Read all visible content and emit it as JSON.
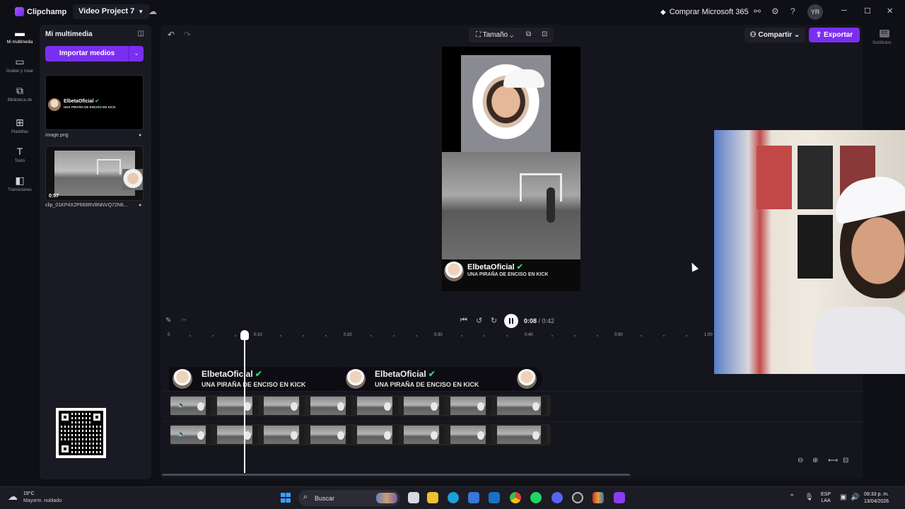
{
  "titlebar": {
    "app_name": "Clipchamp",
    "project_name": "Video Project 7",
    "buy_label": "Comprar Microsoft 365",
    "avatar_initials": "YR"
  },
  "rail": {
    "items": [
      {
        "label": "Mi multimedia",
        "icon": "folder-icon"
      },
      {
        "label": "Grabar y crear",
        "icon": "camera-icon"
      },
      {
        "label": "Biblioteca de",
        "icon": "library-icon"
      },
      {
        "label": "Plantillas",
        "icon": "templates-icon"
      },
      {
        "label": "Texto",
        "icon": "text-icon"
      },
      {
        "label": "Transiciones",
        "icon": "transitions-icon"
      }
    ]
  },
  "media": {
    "title": "Mi multimedia",
    "import_label": "Importar medios",
    "items": [
      {
        "name": "image.png"
      },
      {
        "name": "clip_01KP4X2P669RV8NNVQ72N6...",
        "duration": "0:57"
      }
    ]
  },
  "toolbar": {
    "size_label": "Tamaño",
    "share_label": "Compartir",
    "export_label": "Exportar",
    "subtitles_label": "Subtítulos",
    "subtitles_icon_text": "CC"
  },
  "overlay": {
    "channel_name": "ElbetaOficial",
    "verified_mark": "✔",
    "subtitle": "UNA PIRAÑA DE ENCISO EN KICK"
  },
  "transport": {
    "current_time": "0:08",
    "total_time": "/ 0:42"
  },
  "ruler": {
    "labels": [
      "0",
      "0:10",
      "0:20",
      "0:30",
      "0:40",
      "0:50",
      "1:00"
    ]
  },
  "taskbar": {
    "weather_temp": "19°C",
    "weather_desc": "Mayorm. nublado",
    "search_placeholder": "Buscar",
    "lang_line1": "ESP",
    "lang_line2": "LAA",
    "time": "09:33 p. m.",
    "date": "13/04/2026"
  },
  "colors": {
    "accent": "#7a2ff0",
    "verified": "#2fd26a",
    "background": "#0f0f16",
    "panel": "#1a1a24"
  }
}
